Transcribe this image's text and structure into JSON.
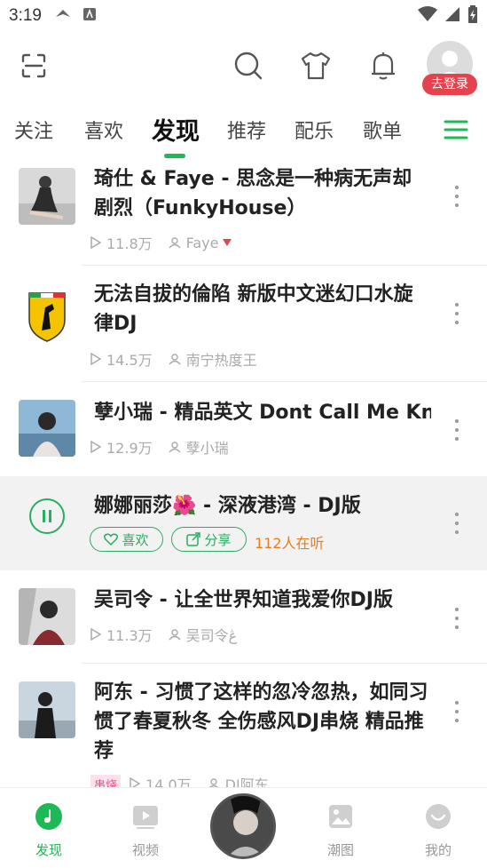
{
  "status_bar": {
    "time": "3:19"
  },
  "header": {
    "login_badge": "去登录"
  },
  "tabs": [
    {
      "label": "关注"
    },
    {
      "label": "喜欢"
    },
    {
      "label": "发现",
      "active": true
    },
    {
      "label": "推荐"
    },
    {
      "label": "配乐"
    },
    {
      "label": "歌单"
    }
  ],
  "songs": [
    {
      "title": "琦仕 & Faye - 思念是一种病无声却剧烈（FunkyHouse）",
      "plays": "11.8万",
      "uploader": "Faye"
    },
    {
      "title": "无法自拔的倫陷  新版中文迷幻口水旋律DJ",
      "plays": "14.5万",
      "uploader": "南宁热度王"
    },
    {
      "title": "孽小瑞 - 精品英文 Dont Call Me Know",
      "plays": "12.9万",
      "uploader": "孽小瑞"
    },
    {
      "title": "娜娜丽莎🌺 - 深液港湾 - DJ版",
      "like_label": "喜欢",
      "share_label": "分享",
      "listeners": "112人在听"
    },
    {
      "title": "吴司令 - 让全世界知道我爱你DJ版",
      "plays": "11.3万",
      "uploader": "吴司令ڠ"
    },
    {
      "title": "阿东 - 习惯了这样的忽冷忽热，如同习惯了春夏秋冬 全伤感风DJ串烧 精品推荐",
      "tag": "串烧",
      "plays": "14.0万",
      "uploader": "DJ阿东"
    }
  ],
  "bottom_nav": [
    {
      "label": "发现",
      "active": true
    },
    {
      "label": "视频"
    },
    {
      "label": "潮图"
    },
    {
      "label": "我的"
    }
  ],
  "colors": {
    "accent": "#1db954",
    "badge": "#e5424d",
    "listeners": "#e67e22"
  },
  "icons": [
    "scan-icon",
    "search-icon",
    "shirt-icon",
    "bell-icon",
    "menu-icon",
    "play-count-icon",
    "user-icon",
    "more-icon",
    "pause-icon",
    "heart-icon",
    "share-icon",
    "music-icon",
    "video-icon",
    "image-icon",
    "profile-icon"
  ]
}
